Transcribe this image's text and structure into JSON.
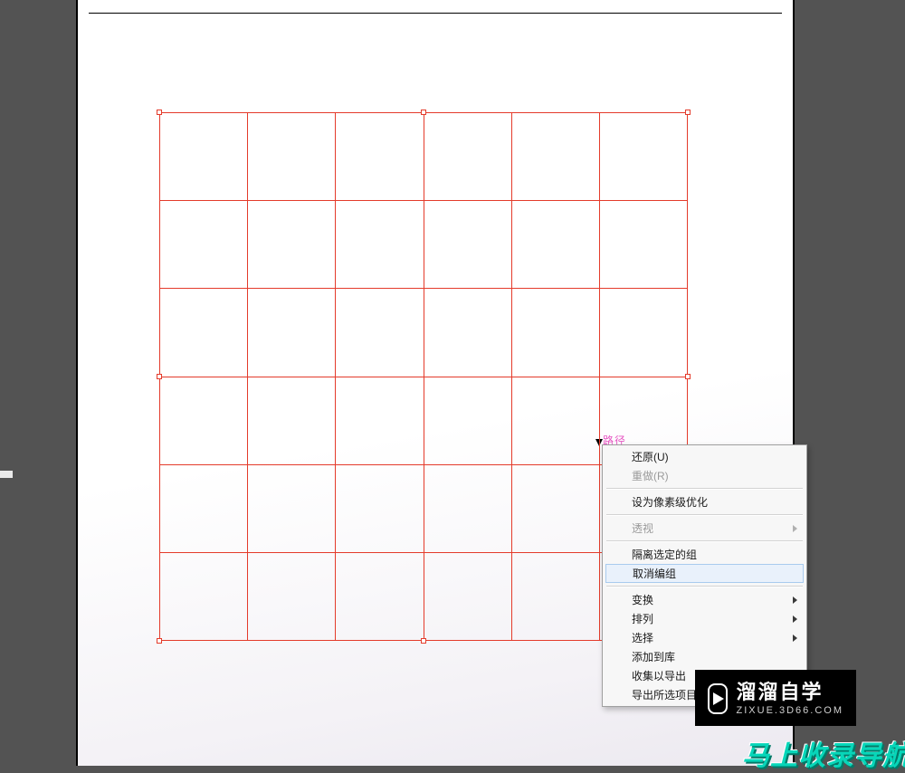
{
  "colors": {
    "workspace_bg": "#535353",
    "grid_line": "#e43b2b",
    "menu_highlight_bg": "#e9f1fb",
    "menu_highlight_border": "#a9cbee",
    "banner_fg": "#07d6b9"
  },
  "canvas": {
    "path_label": "路径",
    "grid_rows": 6,
    "grid_cols": 6
  },
  "context_menu": {
    "items": [
      {
        "label": "还原(U)",
        "enabled": true,
        "submenu": false,
        "highlight": false
      },
      {
        "label": "重做(R)",
        "enabled": false,
        "submenu": false,
        "highlight": false
      },
      {
        "sep": true
      },
      {
        "label": "设为像素级优化",
        "enabled": true,
        "submenu": false,
        "highlight": false
      },
      {
        "sep": true
      },
      {
        "label": "透视",
        "enabled": false,
        "submenu": true,
        "highlight": false
      },
      {
        "sep": true
      },
      {
        "label": "隔离选定的组",
        "enabled": true,
        "submenu": false,
        "highlight": false
      },
      {
        "label": "取消编组",
        "enabled": true,
        "submenu": false,
        "highlight": true
      },
      {
        "sep": true
      },
      {
        "label": "变换",
        "enabled": true,
        "submenu": true,
        "highlight": false
      },
      {
        "label": "排列",
        "enabled": true,
        "submenu": true,
        "highlight": false
      },
      {
        "label": "选择",
        "enabled": true,
        "submenu": true,
        "highlight": false
      },
      {
        "label": "添加到库",
        "enabled": true,
        "submenu": false,
        "highlight": false
      },
      {
        "label": "收集以导出",
        "enabled": true,
        "submenu": false,
        "highlight": false
      },
      {
        "label": "导出所选项目",
        "enabled": true,
        "submenu": false,
        "highlight": false
      }
    ]
  },
  "watermark": {
    "title_cn": "溜溜自学",
    "url": "ZIXUE.3D66.COM"
  },
  "banner": {
    "text": "马上收录导航"
  }
}
